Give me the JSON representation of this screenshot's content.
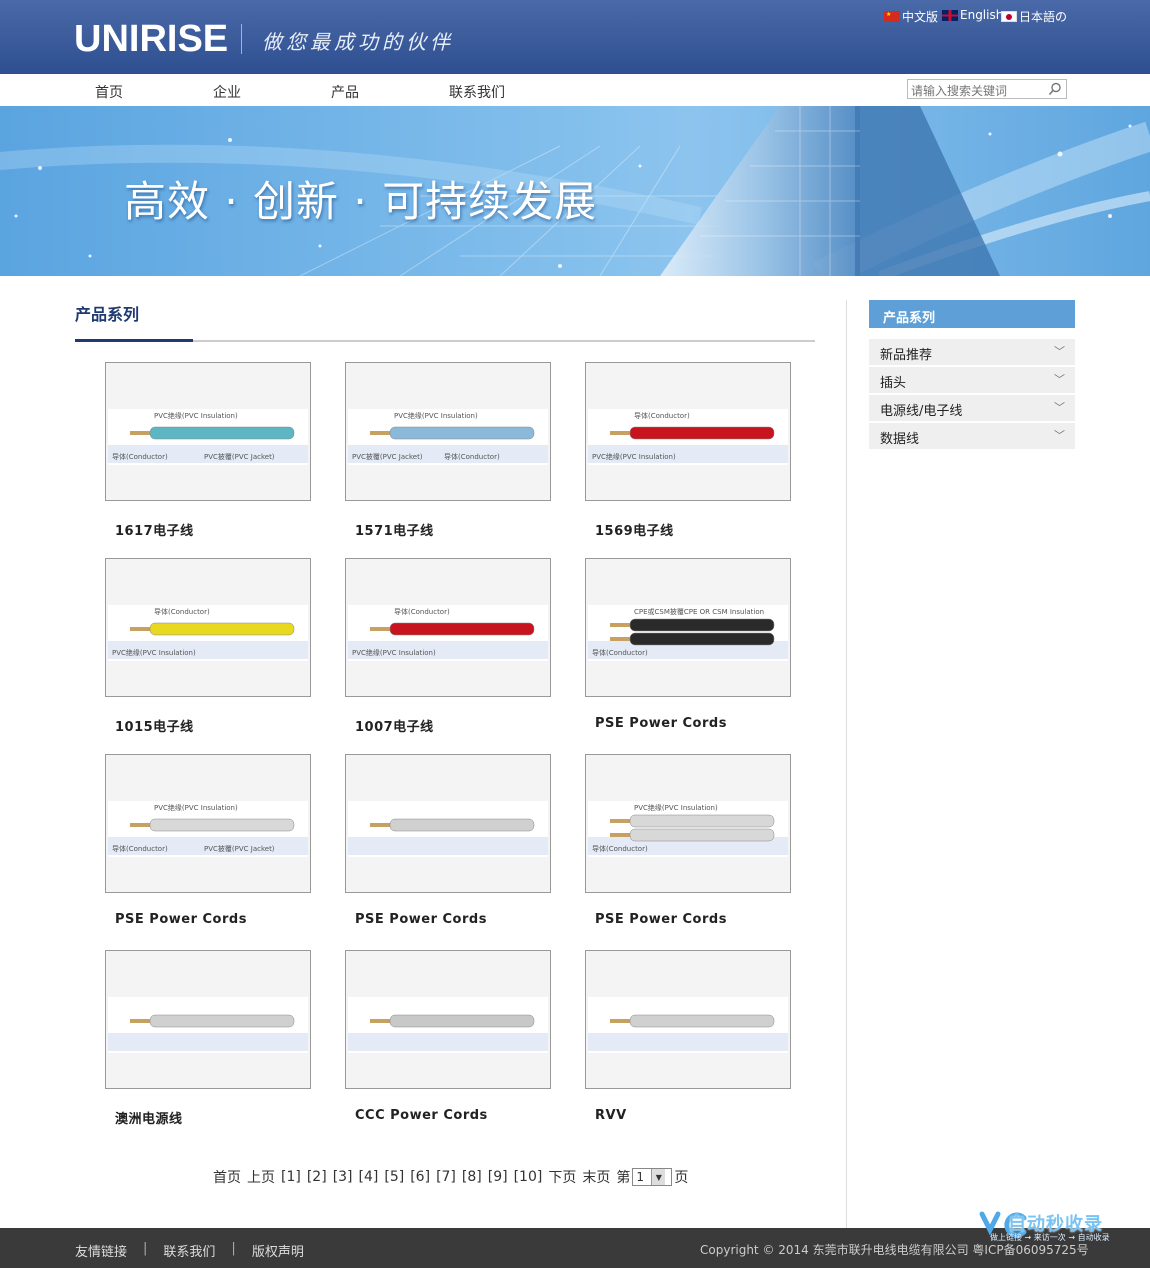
{
  "header": {
    "logo": "UNIRISE",
    "slogan": "做您最成功的伙伴",
    "languages": [
      {
        "label": "中文版",
        "flag": "cn-flag-icon"
      },
      {
        "label": "English",
        "flag": "uk-flag-icon"
      },
      {
        "label": "日本語の",
        "flag": "jp-flag-icon"
      }
    ]
  },
  "nav": {
    "items": [
      "首页",
      "企业",
      "产品",
      "联系我们"
    ],
    "search_placeholder": "请输入搜索关键词"
  },
  "banner": {
    "slogan": "高效 · 创新 · 可持续发展"
  },
  "main": {
    "section_title": "产品系列",
    "products": [
      {
        "title": "1617电子线",
        "labels": [
          "PVC绝缘(PVC Insulation)",
          "导体(Conductor)",
          "PVC披覆(PVC Jacket)"
        ],
        "cable_color": "#5cb6c4"
      },
      {
        "title": "1571电子线",
        "labels": [
          "PVC绝缘(PVC Insulation)",
          "PVC披覆(PVC Jacket)",
          "导体(Conductor)"
        ],
        "cable_color": "#8ab9d9"
      },
      {
        "title": "1569电子线",
        "labels": [
          "导体(Conductor)",
          "PVC绝缘(PVC Insulation)"
        ],
        "cable_color": "#c8141e"
      },
      {
        "title": "1015电子线",
        "labels": [
          "导体(Conductor)",
          "PVC绝缘(PVC Insulation)"
        ],
        "cable_color": "#e8d820"
      },
      {
        "title": "1007电子线",
        "labels": [
          "导体(Conductor)",
          "PVC绝缘(PVC Insulation)"
        ],
        "cable_color": "#c8141e"
      },
      {
        "title": "PSE Power Cords",
        "labels": [
          "CPE或CSM披覆CPE OR CSM Insulation",
          "导体(Conductor)"
        ],
        "cable_color": "#2a2a2a"
      },
      {
        "title": "PSE Power Cords",
        "labels": [
          "PVC绝缘(PVC Insulation)",
          "导体(Conductor)",
          "PVC披覆(PVC Jacket)"
        ],
        "cable_color": "#d8d8d8"
      },
      {
        "title": "PSE Power Cords",
        "labels": [],
        "cable_color": "#d0d0d0"
      },
      {
        "title": "PSE Power Cords",
        "labels": [
          "PVC绝缘(PVC Insulation)",
          "导体(Conductor)"
        ],
        "cable_color": "#d8d8d8"
      },
      {
        "title": "澳洲电源线",
        "labels": [],
        "cable_color": "#d0d0d0"
      },
      {
        "title": "CCC Power Cords",
        "labels": [],
        "cable_color": "#c8c8c8"
      },
      {
        "title": "RVV",
        "labels": [],
        "cable_color": "#d0d0d0"
      }
    ],
    "pagination": {
      "first": "首页",
      "prev": "上页",
      "pages": [
        "[1]",
        "[2]",
        "[3]",
        "[4]",
        "[5]",
        "[6]",
        "[7]",
        "[8]",
        "[9]",
        "[10]"
      ],
      "next": "下页",
      "last": "末页",
      "goto_prefix": "第",
      "current": "1",
      "goto_suffix": "页"
    }
  },
  "sidebar": {
    "title": "产品系列",
    "items": [
      "新品推荐",
      "插头",
      "电源线/电子线",
      "数据线"
    ]
  },
  "footer": {
    "links": [
      "友情链接",
      "联系我们",
      "版权声明"
    ],
    "copyright": "Copyright © 2014 东莞市联升电线电缆有限公司 粤ICP备06095725号",
    "watermark_title": "自动秒收录",
    "watermark_sub": "做上链接 → 来访一次 → 自动收录"
  }
}
